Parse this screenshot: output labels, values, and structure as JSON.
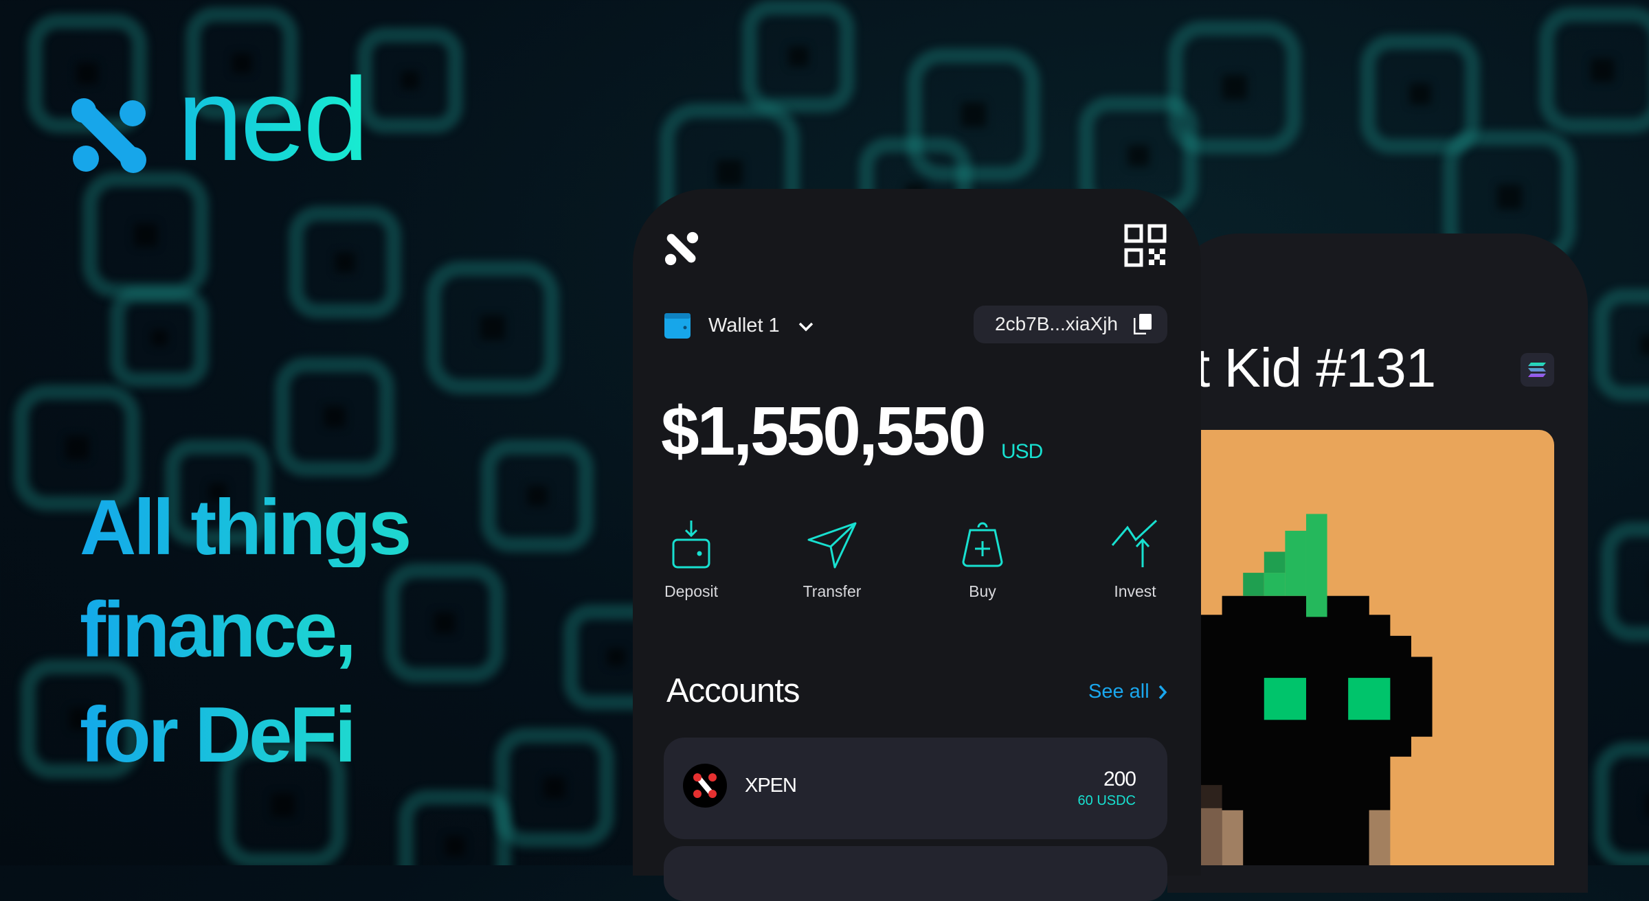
{
  "brand": {
    "name": "ned",
    "logo_icon": "ned-x-logo-icon",
    "icon_color": "#17a6ea",
    "text_gradient": [
      "#13c2df",
      "#18ecd0"
    ]
  },
  "headline": {
    "lines": [
      "All things",
      "finance,",
      "for DeFi"
    ]
  },
  "wallet_app": {
    "qr_icon": "qr-code-icon",
    "wallet_name": "Wallet 1",
    "address": "2cb7B...xiaXjh",
    "balance": "$1,550,550",
    "currency": "USD",
    "actions": [
      {
        "label": "Deposit",
        "icon": "deposit-icon"
      },
      {
        "label": "Transfer",
        "icon": "send-icon"
      },
      {
        "label": "Buy",
        "icon": "shopping-bag-icon"
      },
      {
        "label": "Invest",
        "icon": "invest-chart-icon"
      }
    ],
    "accounts_title": "Accounts",
    "see_all": "See all",
    "accounts": [
      {
        "name": "XPEN",
        "amount": "200",
        "sub_amount": "60 USDC"
      }
    ],
    "accent": "#18e0d0",
    "link_color": "#1aa7ee"
  },
  "nft_screen": {
    "title": "t Kid #131",
    "chain_icon": "solana-icon",
    "art_bg": "#e9a55a"
  }
}
